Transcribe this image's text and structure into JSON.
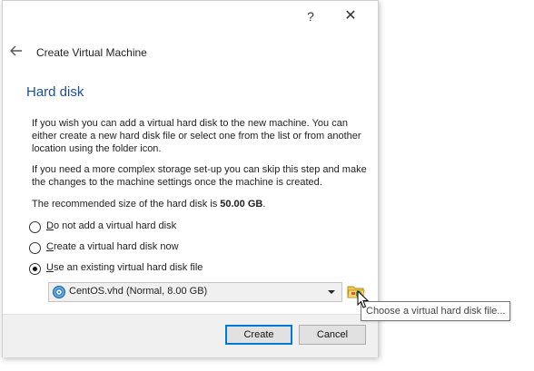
{
  "titlebar": {
    "help_glyph": "?",
    "close_glyph": "✕"
  },
  "header": {
    "back_icon": "back-arrow-icon",
    "title": "Create Virtual Machine"
  },
  "page": {
    "heading": "Hard disk",
    "para1": "If you wish you can add a virtual hard disk to the new machine. You can either create a new hard disk file or select one from the list or from another location using the folder icon.",
    "para2": "If you need a more complex storage set-up you can skip this step and make the changes to the machine settings once the machine is created.",
    "recommend_prefix": "The recommended size of the hard disk is ",
    "recommend_value": "50.00 GB",
    "recommend_suffix": "."
  },
  "options": [
    {
      "label_first": "D",
      "label_rest": "o not add a virtual hard disk",
      "checked": false
    },
    {
      "label_first": "C",
      "label_rest": "reate a virtual hard disk now",
      "checked": false
    },
    {
      "label_first": "U",
      "label_rest": "se an existing virtual hard disk file",
      "checked": true
    }
  ],
  "disk_select": {
    "value": "CentOS.vhd (Normal, 8.00 GB)",
    "icon": "hard-disk-icon"
  },
  "folder_button": {
    "icon": "folder-icon",
    "tooltip": "Choose a virtual hard disk file..."
  },
  "buttons": {
    "create": "Create",
    "cancel": "Cancel"
  },
  "colors": {
    "heading": "#1a4f9c",
    "default_button_border": "#0078d7",
    "footer_bg": "#f0f0f0"
  }
}
